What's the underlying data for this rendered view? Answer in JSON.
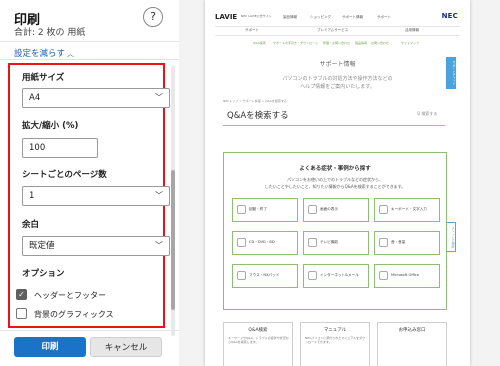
{
  "dialog": {
    "title": "印刷",
    "subtitle": "合計: 2 枚の 用紙",
    "help": "?",
    "less_settings": "設定を減らす",
    "paper_size": {
      "label": "用紙サイズ",
      "value": "A4"
    },
    "scale": {
      "label": "拡大/縮小 (%)",
      "value": "100"
    },
    "pages_per_sheet": {
      "label": "シートごとのページ数",
      "value": "1"
    },
    "margins": {
      "label": "余白",
      "value": "既定値"
    },
    "options": {
      "label": "オプション",
      "headers_footers": {
        "label": "ヘッダーとフッター",
        "checked": true
      },
      "background_graphics": {
        "label": "背景のグラフィックス",
        "checked": false
      }
    },
    "print_button": "印刷",
    "cancel_button": "キャンセル",
    "highlight_color": "#e8141a",
    "accent_color": "#1a73c8"
  },
  "preview": {
    "logo": "LAVIE",
    "logo_sub": "NEC LAVIE公式サイト",
    "brand": "NEC",
    "top_nav": [
      "製品情報",
      "ショッピング",
      "サポート情報",
      "サポート"
    ],
    "sub_nav": [
      "サポート",
      "プレミアムサービス",
      "活用情報"
    ],
    "links": [
      "Q&A検索",
      "サポートの手引き・ダウンロード",
      "修理・お問い合わせ",
      "製品情報",
      "お問い合わせ",
      "サイトマップ"
    ],
    "section_title": "サポート情報",
    "section_desc": [
      "パソコンのトラブルの対処方法や操作方法などの",
      "ヘルプ情報をご案内いたします。"
    ],
    "breadcrumb": "NECトップ > サポート情報 > Q&Aを検索する",
    "side_tab": "サポートチャット",
    "side_tab2": "チャットで相談",
    "qa_title": "Q&Aを検索する",
    "qa_search": "Q 検索する",
    "box_title": "よくある症状・事例から探す",
    "box_desc": [
      "パソコンをお使いの上でのトラブルなどの症状から、",
      "したいことやしたいこと、知りたい情報からQ&Aを検索することができます。"
    ],
    "tiles": [
      "起動・終了",
      "画面の表示",
      "キーボード・文字入力",
      "CD・DVD・BD",
      "テレビ機能",
      "音・音量",
      "マウス・NXパッド",
      "インターネット&メール",
      "Microsoft Office"
    ],
    "columns": [
      {
        "title": "Q&A検索",
        "body": "キーワードやQ&A、トラブルの症状や状況からQ&Aを検索します。"
      },
      {
        "title": "マニュアル",
        "body": "NECパソコンに添付されたマニュアルをダウンロードできます。"
      },
      {
        "title": "お申込み窓口",
        "body": ""
      }
    ]
  }
}
